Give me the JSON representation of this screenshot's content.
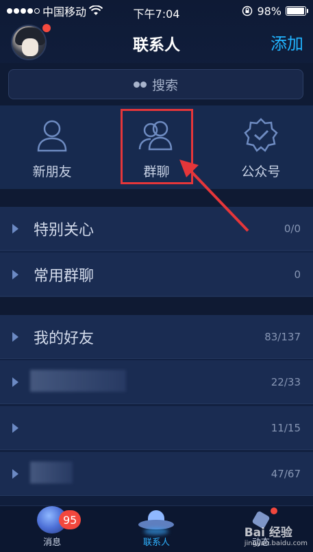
{
  "status_bar": {
    "carrier": "中国移动",
    "time": "下午7:04",
    "battery": "98%",
    "battery_level": 0.98
  },
  "nav": {
    "title": "联系人",
    "add_label": "添加"
  },
  "search": {
    "placeholder": "搜索"
  },
  "quick_entries": [
    {
      "label": "新朋友",
      "icon": "person-icon"
    },
    {
      "label": "群聊",
      "icon": "group-icon"
    },
    {
      "label": "公众号",
      "icon": "badge-check-icon"
    }
  ],
  "groups": [
    {
      "label": "特别关心",
      "count": "0/0"
    },
    {
      "label": "常用群聊",
      "count": "0"
    },
    {
      "label": "我的好友",
      "count": "83/137"
    },
    {
      "label": "",
      "count": "22/33"
    },
    {
      "label": "",
      "count": "11/15"
    },
    {
      "label": "",
      "count": "47/67"
    }
  ],
  "tabs": [
    {
      "label": "消息",
      "badge": "95"
    },
    {
      "label": "联系人"
    },
    {
      "label": "动态"
    }
  ],
  "watermark": {
    "text": "Bai 经验",
    "sub": "jingyan.baidu.com"
  },
  "colors": {
    "accent": "#21b4ff",
    "badge": "#f2473d",
    "highlight": "#e5363a"
  }
}
